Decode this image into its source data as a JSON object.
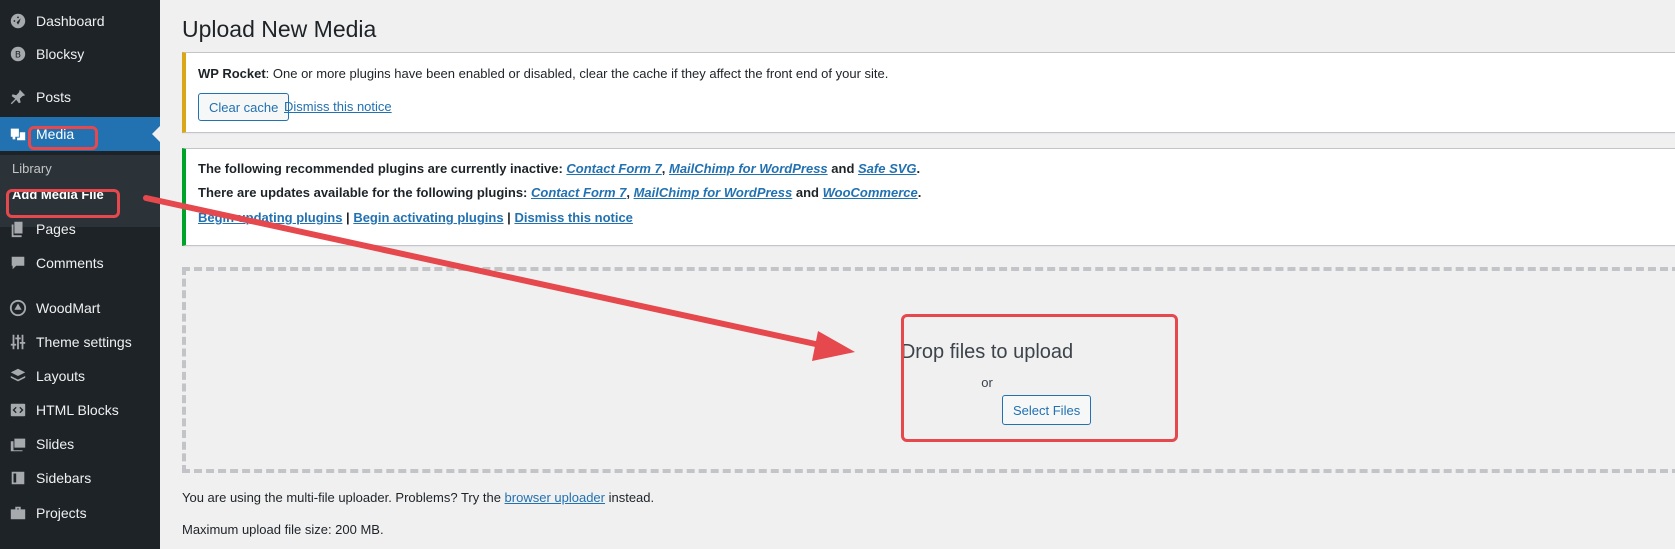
{
  "sidebar": {
    "items": [
      {
        "label": "Dashboard",
        "icon": "dashboard-icon"
      },
      {
        "label": "Blocksy",
        "icon": "blocksy-icon"
      },
      {
        "label": "Posts",
        "icon": "pin-icon"
      },
      {
        "label": "Media",
        "icon": "media-icon"
      },
      {
        "label": "Pages",
        "icon": "pages-icon"
      },
      {
        "label": "Comments",
        "icon": "comments-icon"
      },
      {
        "label": "WoodMart",
        "icon": "woodmart-icon"
      },
      {
        "label": "Theme settings",
        "icon": "sliders-icon"
      },
      {
        "label": "Layouts",
        "icon": "layers-icon"
      },
      {
        "label": "HTML Blocks",
        "icon": "code-icon"
      },
      {
        "label": "Slides",
        "icon": "slides-icon"
      },
      {
        "label": "Sidebars",
        "icon": "sidebar-icon"
      },
      {
        "label": "Projects",
        "icon": "briefcase-icon"
      }
    ],
    "submenu": {
      "library": "Library",
      "add_media": "Add Media File"
    }
  },
  "page": {
    "title": "Upload New Media"
  },
  "notice_rocket": {
    "brand": "WP Rocket",
    "message": ": One or more plugins have been enabled or disabled, clear the cache if they affect the front end of your site.",
    "clear_cache": "Clear cache",
    "dismiss": "Dismiss this notice"
  },
  "notice_plugins": {
    "line1_prefix": "The following recommended plugins are currently inactive: ",
    "line1_p1": "Contact Form 7",
    "line1_sep": ", ",
    "line1_p2": "MailChimp for WordPress",
    "line1_and": " and ",
    "line1_p3": "Safe SVG",
    "line1_end": ".",
    "line2_prefix": "There are updates available for the following plugins: ",
    "line2_p1": "Contact Form 7",
    "line2_sep": ", ",
    "line2_p2": "MailChimp for WordPress",
    "line2_and": " and ",
    "line2_p3": "WooCommerce",
    "line2_end": ".",
    "begin_updating": "Begin updating plugins",
    "pipe1": " | ",
    "begin_activating": "Begin activating plugins",
    "pipe2": " | ",
    "dismiss": "Dismiss this notice"
  },
  "uploader": {
    "drop_title": "Drop files to upload",
    "or": "or",
    "select_files": "Select Files"
  },
  "info": {
    "multi_prefix": "You are using the multi-file uploader. Problems? Try the ",
    "browser_uploader": "browser uploader",
    "multi_suffix": " instead.",
    "max_size": "Maximum upload file size: 200 MB."
  },
  "colors": {
    "sidebar_bg": "#1d2327",
    "accent": "#2271b1",
    "annotation": "#e5484d",
    "warning_border": "#dba617",
    "success_border": "#00a32a"
  }
}
